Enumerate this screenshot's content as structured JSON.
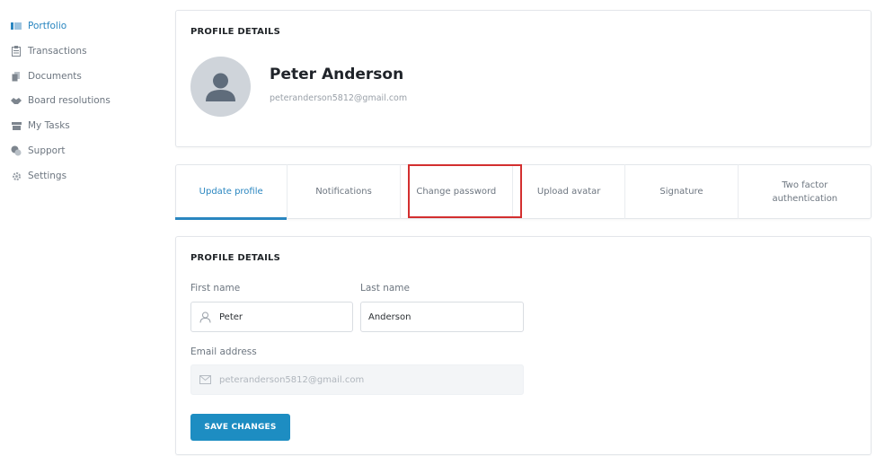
{
  "sidebar": {
    "items": [
      {
        "label": "Portfolio",
        "icon": "portfolio-icon"
      },
      {
        "label": "Transactions",
        "icon": "clipboard-icon"
      },
      {
        "label": "Documents",
        "icon": "documents-icon"
      },
      {
        "label": "Board resolutions",
        "icon": "handshake-icon"
      },
      {
        "label": "My Tasks",
        "icon": "tasks-icon"
      },
      {
        "label": "Support",
        "icon": "support-icon"
      },
      {
        "label": "Settings",
        "icon": "gear-icon"
      }
    ]
  },
  "profile": {
    "section_title": "PROFILE DETAILS",
    "name": "Peter Anderson",
    "email": "peteranderson5812@gmail.com"
  },
  "tabs": [
    {
      "label": "Update profile",
      "active": true
    },
    {
      "label": "Notifications",
      "active": false
    },
    {
      "label": "Change password",
      "active": false
    },
    {
      "label": "Upload avatar",
      "active": false
    },
    {
      "label": "Signature",
      "active": false
    },
    {
      "label": "Two factor authentication",
      "active": false
    }
  ],
  "form": {
    "section_title": "PROFILE DETAILS",
    "first_name_label": "First name",
    "first_name_value": "Peter",
    "last_name_label": "Last name",
    "last_name_value": "Anderson",
    "email_label": "Email address",
    "email_value": "peteranderson5812@gmail.com",
    "save_label": "SAVE CHANGES"
  },
  "colors": {
    "accent": "#2a86c0",
    "button": "#1d8dc2",
    "highlight": "#d32f2f"
  }
}
